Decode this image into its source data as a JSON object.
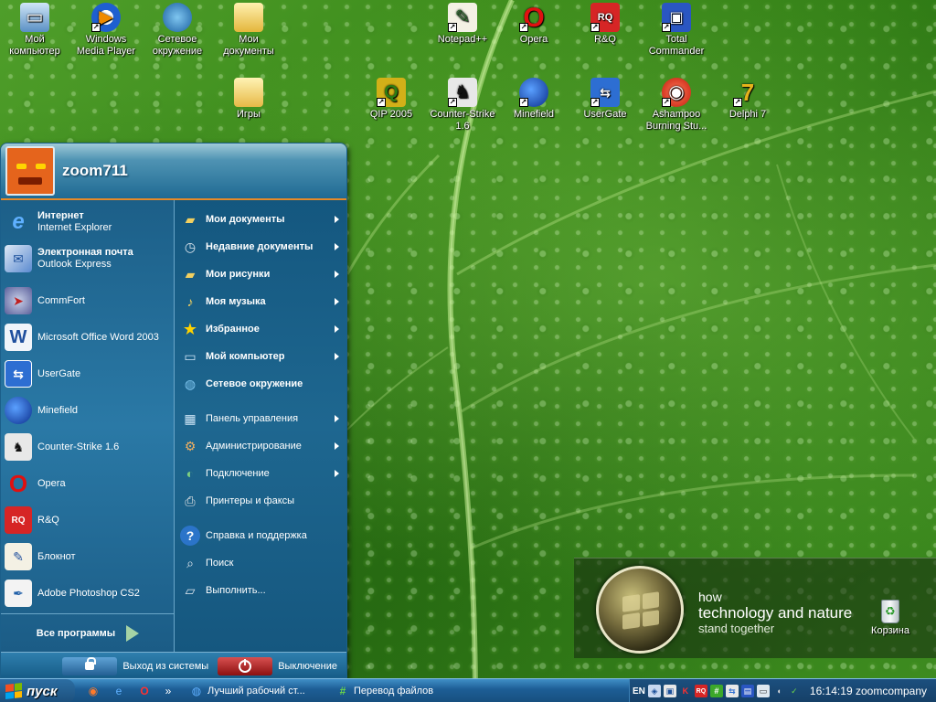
{
  "desktop": {
    "icons": [
      {
        "label": "Мой компьютер",
        "icon": "my-computer-icon",
        "shortcut": false
      },
      {
        "label": "Windows Media Player",
        "icon": "media-player-icon",
        "shortcut": true
      },
      {
        "label": "Сетевое окружение",
        "icon": "network-icon",
        "shortcut": false
      },
      {
        "label": "Мои документы",
        "icon": "my-documents-icon",
        "shortcut": false
      },
      {
        "label": "Игры",
        "icon": "folder-icon",
        "shortcut": false
      },
      {
        "label": "Notepad++",
        "icon": "notepad-plus-icon",
        "shortcut": true
      },
      {
        "label": "Opera",
        "icon": "opera-icon",
        "shortcut": true
      },
      {
        "label": "R&Q",
        "icon": "rnq-icon",
        "shortcut": true
      },
      {
        "label": "Total Commander",
        "icon": "total-commander-icon",
        "shortcut": true
      },
      {
        "label": "QIP 2005",
        "icon": "qip-icon",
        "shortcut": true
      },
      {
        "label": "Counter-Strike 1.6",
        "icon": "counter-strike-icon",
        "shortcut": true
      },
      {
        "label": "Minefield",
        "icon": "minefield-icon",
        "shortcut": true
      },
      {
        "label": "UserGate",
        "icon": "usergate-icon",
        "shortcut": true
      },
      {
        "label": "Ashampoo Burning Stu...",
        "icon": "ashampoo-icon",
        "shortcut": true
      },
      {
        "label": "Delphi 7",
        "icon": "delphi-icon",
        "shortcut": true
      }
    ],
    "recycle_bin": "Корзина",
    "logo": {
      "line1": "how",
      "line2": "technology and nature",
      "line3": "stand together"
    }
  },
  "start_menu": {
    "user_name": "zoom711",
    "pinned": [
      {
        "title": "Интернет",
        "subtitle": "Internet Explorer",
        "icon": "internet-explorer-icon"
      },
      {
        "title": "Электронная почта",
        "subtitle": "Outlook Express",
        "icon": "outlook-express-icon"
      }
    ],
    "recent": [
      {
        "label": "CommFort",
        "icon": "commfort-icon"
      },
      {
        "label": "Microsoft Office Word 2003",
        "icon": "word-icon"
      },
      {
        "label": "UserGate",
        "icon": "usergate-icon"
      },
      {
        "label": "Minefield",
        "icon": "minefield-icon"
      },
      {
        "label": "Counter-Strike 1.6",
        "icon": "counter-strike-icon"
      },
      {
        "label": "Opera",
        "icon": "opera-icon"
      },
      {
        "label": "R&Q",
        "icon": "rnq-icon"
      },
      {
        "label": "Блокнот",
        "icon": "notepad-icon"
      },
      {
        "label": "Adobe Photoshop CS2",
        "icon": "photoshop-icon"
      }
    ],
    "all_programs": "Все программы",
    "right_group1": [
      {
        "label": "Мои документы",
        "icon": "my-documents-icon",
        "submenu": true
      },
      {
        "label": "Недавние документы",
        "icon": "recent-documents-icon",
        "submenu": true
      },
      {
        "label": "Мои рисунки",
        "icon": "my-pictures-icon",
        "submenu": true
      },
      {
        "label": "Моя музыка",
        "icon": "my-music-icon",
        "submenu": true
      },
      {
        "label": "Избранное",
        "icon": "favorites-icon",
        "submenu": true
      },
      {
        "label": "Мой компьютер",
        "icon": "my-computer-icon",
        "submenu": true
      },
      {
        "label": "Сетевое окружение",
        "icon": "network-icon",
        "submenu": false
      }
    ],
    "right_group2": [
      {
        "label": "Панель управления",
        "icon": "control-panel-icon",
        "submenu": true
      },
      {
        "label": "Администрирование",
        "icon": "admin-tools-icon",
        "submenu": true
      },
      {
        "label": "Подключение",
        "icon": "connect-icon",
        "submenu": true
      },
      {
        "label": "Принтеры и факсы",
        "icon": "printers-icon",
        "submenu": false
      }
    ],
    "right_group3": [
      {
        "label": "Справка и поддержка",
        "icon": "help-icon"
      },
      {
        "label": "Поиск",
        "icon": "search-icon"
      },
      {
        "label": "Выполнить...",
        "icon": "run-icon"
      }
    ],
    "logoff": "Выход из системы",
    "shutdown": "Выключение"
  },
  "taskbar": {
    "start_label": "пуск",
    "quick_launch_overflow": "»",
    "tasks": [
      {
        "label": "Лучший рабочий ст...",
        "icon": "browser-icon"
      },
      {
        "label": "Перевод файлов",
        "icon": "transfer-icon"
      }
    ],
    "tray": {
      "language": "EN",
      "time": "16:14:19",
      "computer_name": "zoomcompany"
    }
  },
  "colors": {
    "accent_orange": "#e58a2a",
    "start_menu_blue": "#1c5f88",
    "taskbar_blue": "#1d5d95"
  }
}
